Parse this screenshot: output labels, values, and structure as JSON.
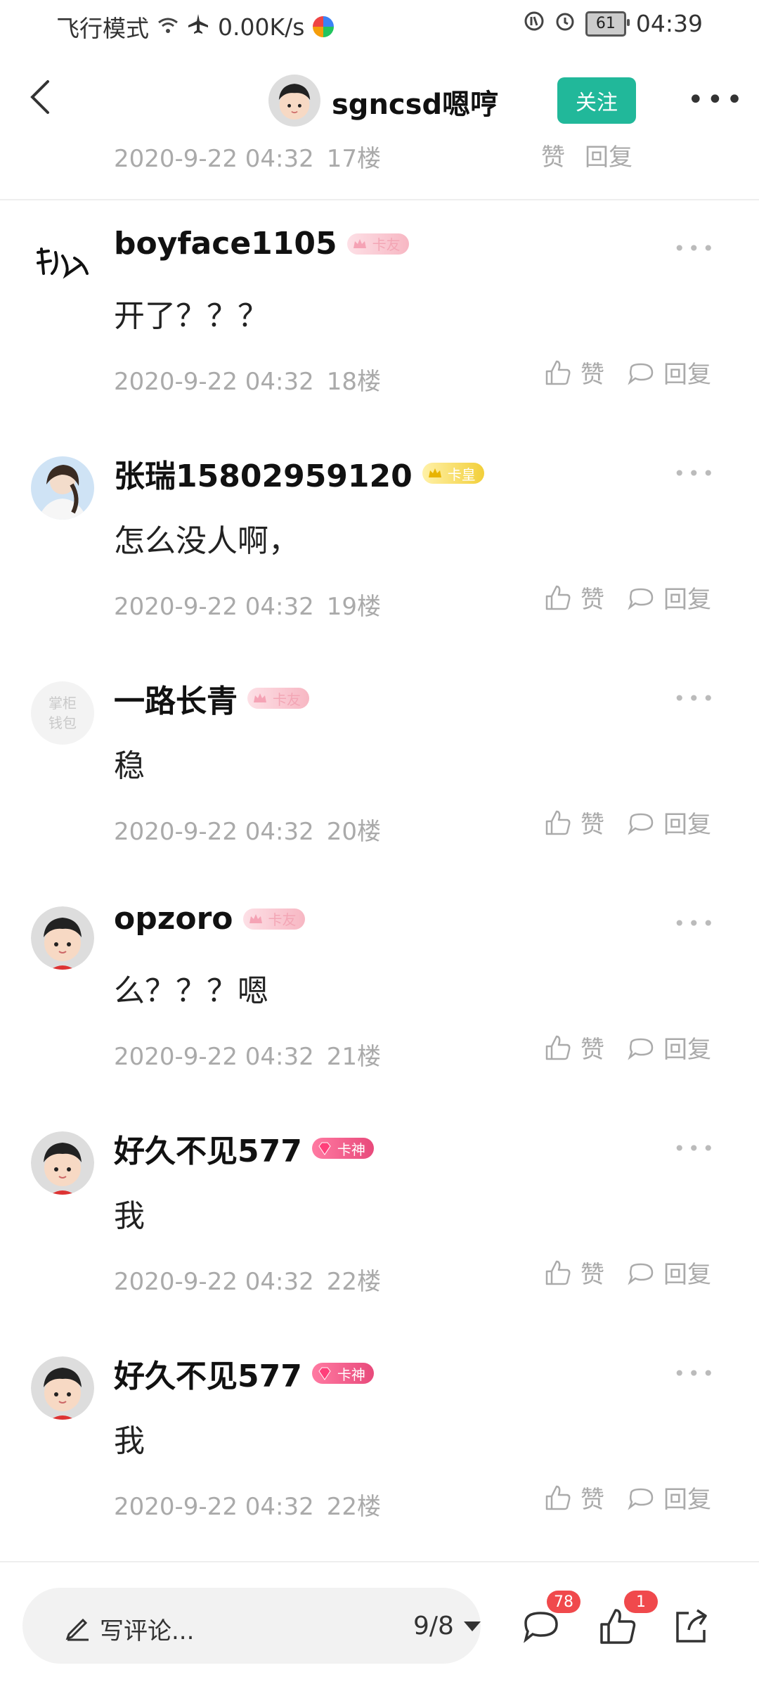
{
  "status_bar": {
    "mode_text": "飞行模式",
    "speed": "0.00K/s",
    "battery": "61",
    "time": "04:39"
  },
  "header": {
    "username": "sgncsd嗯哼",
    "follow_label": "关注"
  },
  "partial_post": {
    "date": "2020-9-22 04:32",
    "floor": "17楼",
    "like_label": "赞",
    "reply_label": "回复"
  },
  "posts": [
    {
      "username": "boyface1105",
      "badge": "卡友",
      "content": "开了？？？",
      "date": "2020-9-22 04:32",
      "floor": "18楼",
      "like_label": "赞",
      "reply_label": "回复"
    },
    {
      "username": "张瑞15802959120",
      "badge": "卡皇",
      "content": "怎么没人啊，",
      "date": "2020-9-22 04:32",
      "floor": "19楼",
      "like_label": "赞",
      "reply_label": "回复"
    },
    {
      "username": "一路长青",
      "badge": "卡友",
      "content": "稳",
      "date": "2020-9-22 04:32",
      "floor": "20楼",
      "like_label": "赞",
      "reply_label": "回复",
      "avatar_text": "掌柜钱包"
    },
    {
      "username": "opzoro",
      "badge": "卡友",
      "content": "么？？？嗯",
      "date": "2020-9-22 04:32",
      "floor": "21楼",
      "like_label": "赞",
      "reply_label": "回复"
    },
    {
      "username": "好久不见577",
      "badge": "卡神",
      "content": "我",
      "date": "2020-9-22 04:32",
      "floor": "22楼",
      "like_label": "赞",
      "reply_label": "回复"
    },
    {
      "username": "好久不见577",
      "badge": "卡神",
      "content": "我",
      "date": "2020-9-22 04:32",
      "floor": "22楼",
      "like_label": "赞",
      "reply_label": "回复"
    }
  ],
  "bottom_bar": {
    "comment_placeholder": "写评论...",
    "page_indicator": "9/8",
    "comments_count": "78",
    "likes_count": "1"
  },
  "colors": {
    "accent": "#21b89a",
    "badge_red": "#f0494c",
    "meta_gray": "#aaaaaa"
  }
}
